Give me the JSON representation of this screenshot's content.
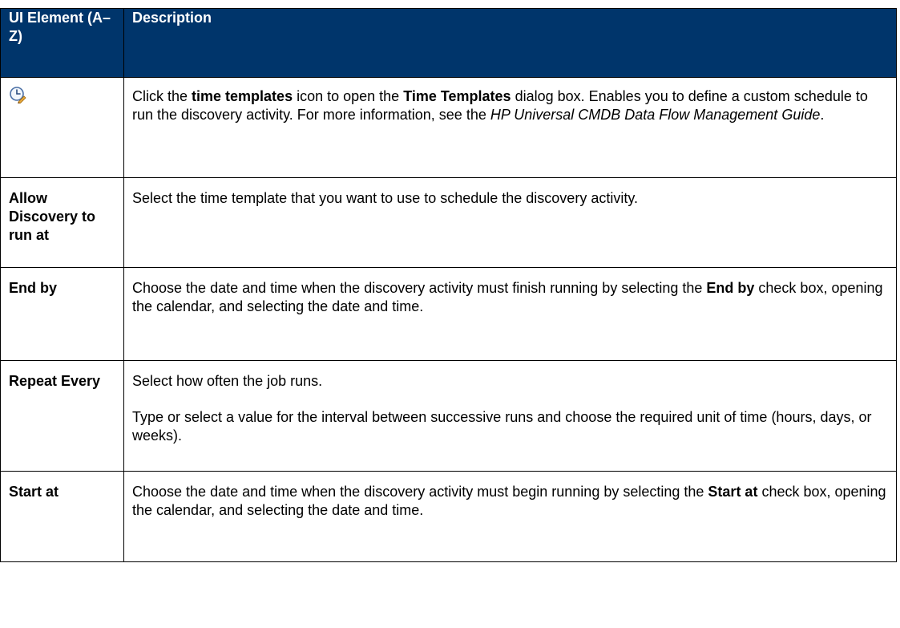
{
  "table": {
    "header": {
      "col1": "UI Element (A–Z)",
      "col2": "Description"
    },
    "rows": [
      {
        "element_icon": "time-templates-icon",
        "desc": {
          "t1": "Click the ",
          "b1": "time templates",
          "t2": " icon to open the ",
          "b2": "Time Templates",
          "t3": " dialog box. Enables you to define a custom schedule to run the discovery activity. For more information, see the ",
          "i1": "HP Universal CMDB Data Flow Management Guide",
          "t4": "."
        }
      },
      {
        "element": "Allow Discovery to run at",
        "desc": {
          "t1": "Select the time template that you want to use to schedule the discovery activity."
        }
      },
      {
        "element": "End by",
        "desc": {
          "t1": "Choose the date and time when the discovery activity must finish running by selecting the ",
          "b1": "End by",
          "t2": " check box, opening the calendar, and selecting the date and time."
        }
      },
      {
        "element": "Repeat Every",
        "desc": {
          "p1": "Select how often the job runs.",
          "p2": "Type or select a value for the interval between successive runs and choose the required unit of time (hours, days, or weeks)."
        }
      },
      {
        "element": "Start at",
        "desc": {
          "t1": "Choose the date and time when the discovery activity must begin running by selecting the ",
          "b1": "Start at",
          "t2": " check box, opening the calendar, and selecting the date and time."
        }
      }
    ]
  },
  "colors": {
    "header_bg": "#00356b",
    "header_text": "#ffffff",
    "border": "#000000",
    "icon_accent": "#e8a93b"
  }
}
